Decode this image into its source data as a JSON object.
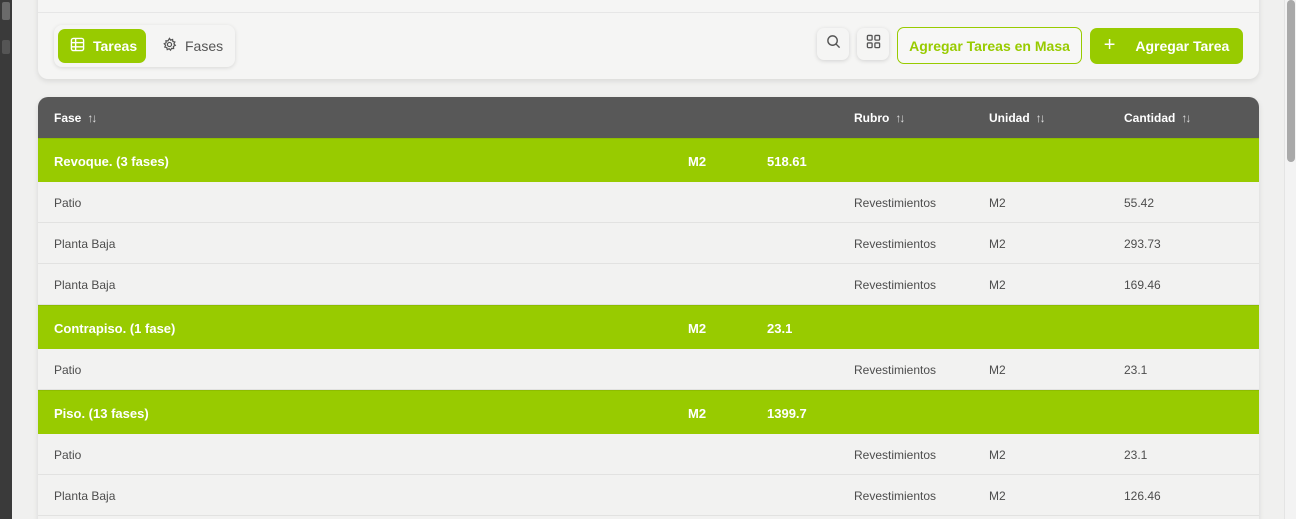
{
  "toolbar": {
    "tabs": [
      {
        "label": "Tareas",
        "icon": "table-icon",
        "active": true
      },
      {
        "label": "Fases",
        "icon": "gear-icon",
        "active": false
      }
    ],
    "search_icon": "search-icon",
    "grid_icon": "grid-icon",
    "bulk_add_label": "Agregar Tareas en Masa",
    "add_label": "Agregar Tarea",
    "add_icon": "plus-icon"
  },
  "colors": {
    "accent": "#98cb00",
    "header_bg": "#585858",
    "row_bg": "#f2f2f1"
  },
  "table": {
    "columns": {
      "fase": "Fase",
      "rubro": "Rubro",
      "unidad": "Unidad",
      "cantidad": "Cantidad",
      "sort_icon": "↑↓"
    },
    "groups": [
      {
        "title": "Revoque. (3 fases)",
        "unidad": "M2",
        "cantidad": "518.61",
        "rows": [
          {
            "fase": "Patio",
            "rubro": "Revestimientos",
            "unidad": "M2",
            "cantidad": "55.42"
          },
          {
            "fase": "Planta Baja",
            "rubro": "Revestimientos",
            "unidad": "M2",
            "cantidad": "293.73"
          },
          {
            "fase": "Planta Baja",
            "rubro": "Revestimientos",
            "unidad": "M2",
            "cantidad": "169.46"
          }
        ]
      },
      {
        "title": "Contrapiso. (1 fase)",
        "unidad": "M2",
        "cantidad": "23.1",
        "rows": [
          {
            "fase": "Patio",
            "rubro": "Revestimientos",
            "unidad": "M2",
            "cantidad": "23.1"
          }
        ]
      },
      {
        "title": "Piso. (13 fases)",
        "unidad": "M2",
        "cantidad": "1399.7",
        "rows": [
          {
            "fase": "Patio",
            "rubro": "Revestimientos",
            "unidad": "M2",
            "cantidad": "23.1"
          },
          {
            "fase": "Planta Baja",
            "rubro": "Revestimientos",
            "unidad": "M2",
            "cantidad": "126.46"
          }
        ]
      }
    ]
  }
}
